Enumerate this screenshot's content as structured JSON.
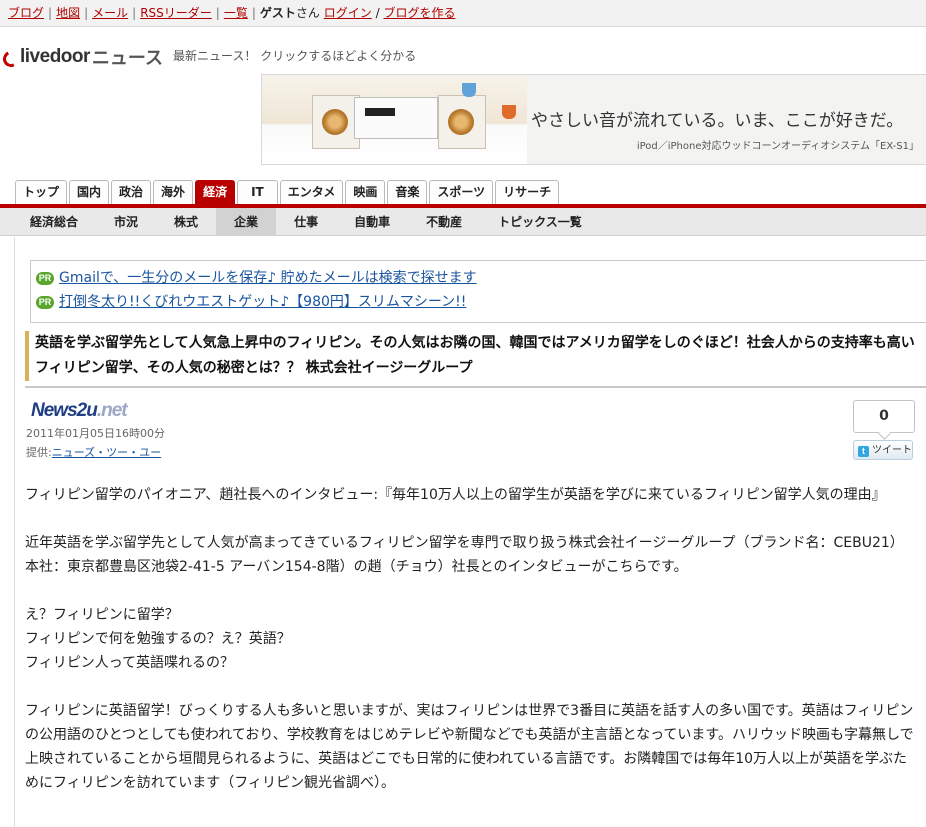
{
  "util": {
    "links": [
      "ブログ",
      "地図",
      "メール",
      "RSSリーダー",
      "一覧"
    ],
    "guest_name": "ゲスト",
    "guest_suffix": "さん",
    "login": "ログイン",
    "slash": "/",
    "create_blog": "ブログを作る"
  },
  "header": {
    "logo_text": "livedoor",
    "logo_news": "ニュース",
    "tagline": "最新ニュース！ クリックするほどよく分かる"
  },
  "banner": {
    "copy": "やさしい音が流れている。いま、ここが好きだ。",
    "sub": "iPod／iPhone対応ウッドコーンオーディオシステム「EX-S1」"
  },
  "tabs": [
    "トップ",
    "国内",
    "政治",
    "海外",
    "経済",
    "IT",
    "エンタメ",
    "映画",
    "音楽",
    "スポーツ",
    "リサーチ"
  ],
  "active_tab": "経済",
  "subnav": [
    "経済総合",
    "市況",
    "株式",
    "企業",
    "仕事",
    "自動車",
    "不動産",
    "トピックス一覧"
  ],
  "active_subnav": "企業",
  "pr": {
    "badge": "PR",
    "items": [
      "Gmailで、一生分のメールを保存♪ 貯めたメールは検索で探せます",
      "打倒冬太り!!くびれウエストゲット♪【980円】スリムマシーン!!"
    ]
  },
  "article": {
    "headline": "英語を学ぶ留学先として人気急上昇中のフィリピン。その人気はお隣の国、韓国ではアメリカ留学をしのぐほど！社会人からの支持率も高いフィリピン留学、その人気の秘密とは？？ 株式会社イージーグループ",
    "source_logo": "News2u",
    "source_logo_net": ".net",
    "date": "2011年01月05日16時00分",
    "provider_label": "提供:",
    "provider_name": "ニューズ・ツー・ユー",
    "tweet_count": "0",
    "tweet_label": "ツイート",
    "tweet_icon": "t",
    "paragraphs": [
      "フィリピン留学のパイオニア、趙社長へのインタビュー:『毎年10万人以上の留学生が英語を学びに来ているフィリピン留学人気の理由』",
      "近年英語を学ぶ留学先として人気が高まってきているフィリピン留学を専門で取り扱う株式会社イージーグループ（ブランド名：CEBU21）本社：東京都豊島区池袋2-41-5 アーバン154-8階）の趙（チョウ）社長とのインタビューがこちらです。",
      "え？フィリピンに留学？\nフィリピンで何を勉強するの？え？英語？\nフィリピン人って英語喋れるの？",
      "フィリピンに英語留学！びっくりする人も多いと思いますが、実はフィリピンは世界で3番目に英語を話す人の多い国です。英語はフィリピンの公用語のひとつとしても使われており、学校教育をはじめテレビや新聞などでも英語が主言語となっています。ハリウッド映画も字幕無しで上映されていることから垣間見られるように、英語はどこでも日常的に使われている言語です。お隣韓国では毎年10万人以上が英語を学ぶためにフィリピンを訪れています（フィリピン観光省調べ）。"
    ]
  }
}
